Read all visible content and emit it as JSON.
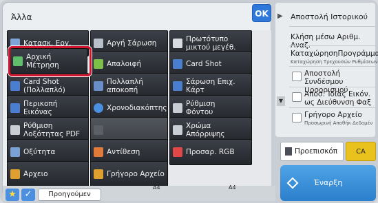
{
  "panel": {
    "title": "Άλλα",
    "ok_label": "OK"
  },
  "buttons": [
    {
      "label": "Κατασκ. Εργ.",
      "icon": "job-build-icon",
      "color": "#7fa4d8",
      "dim": false
    },
    {
      "label": "Αργή Σάρωση",
      "icon": "slow-scan-icon",
      "color": "#b9c0c9",
      "dim": false
    },
    {
      "label": "Πρωτότυπο\nμικτού μεγέθ.",
      "icon": "mixed-size-icon",
      "color": "#d9dde2",
      "dim": false
    },
    {
      "label": "Αρχική\nΜέτρηση",
      "icon": "original-count-icon",
      "color": "#5fbf6a",
      "dim": false
    },
    {
      "label": "Απαλοιφή",
      "icon": "erase-icon",
      "color": "#7cc04a",
      "dim": false
    },
    {
      "label": "Card Shot",
      "icon": "card-shot-icon",
      "color": "#4a7fd0",
      "dim": false
    },
    {
      "label": "Card Shot\n(Πολλαπλό)",
      "icon": "card-shot-multi-icon",
      "color": "#4a7fd0",
      "dim": false
    },
    {
      "label": "Πολλαπλή\nαποκοπή",
      "icon": "multi-crop-icon",
      "color": "#6a8fc8",
      "dim": false
    },
    {
      "label": "Σάρωση Επιχ.\nΚάρτ",
      "icon": "business-card-icon",
      "color": "#4a7fd0",
      "dim": false
    },
    {
      "label": "Περικοπή\nΕικόνας",
      "icon": "image-crop-icon",
      "color": "#4a7fd0",
      "dim": false
    },
    {
      "label": "Χρονοδιακόπτης",
      "icon": "timer-icon",
      "color": "#4a8fe0",
      "dim": false
    },
    {
      "label": "Ρύθμιση\nΦόντου",
      "icon": "background-icon",
      "color": "#c9ced4",
      "dim": false
    },
    {
      "label": "Ρύθμιση\nΛοξότητας PDF",
      "icon": "pdf-skew-icon",
      "color": "#c9ced4",
      "dim": false
    },
    {
      "label": "",
      "icon": "disabled-icon",
      "color": "#5b5f66",
      "dim": true
    },
    {
      "label": "Χρώμα\nΑπόρριψης",
      "icon": "color-drop-icon",
      "color": "#c9ced4",
      "dim": false
    },
    {
      "label": "Οξύτητα",
      "icon": "sharpness-icon",
      "color": "#7aa0d8",
      "dim": false
    },
    {
      "label": "Αντίθεση",
      "icon": "contrast-icon",
      "color": "#e07a3a",
      "dim": false
    },
    {
      "label": "Προσαρ. RGB",
      "icon": "rgb-icon",
      "color": "#e04848",
      "dim": false
    },
    {
      "label": "Αρχειο",
      "icon": "folder-icon",
      "color": "#e0a030",
      "dim": false
    },
    {
      "label": "Γρήγορο Αρχείο",
      "icon": "quick-file-icon",
      "color": "#e0a030",
      "dim": false
    }
  ],
  "right_panel": {
    "title": "Αποστολή Ιστορικού",
    "item1": "Κλήση μέσω Αριθμ. Αναζ.",
    "item2": "ΚαταχώρησηΠρογράμματος",
    "item2_sub": "Καταχώρηση Τρεχουσών Ρυθμίσεων",
    "item3": "Αποστολή Συνδέσμου\nΠροορισμού",
    "item4": "Αποσ. Ίδιας Εικόν.\nως Διεύθυνση Φαξ",
    "item5": "Γρήγορο Αρχείο",
    "item5_sub": "Προσωρινή Αποθήκ Δεδομέν"
  },
  "actions": {
    "preview": "Προεπισκόπ",
    "ca": "CA",
    "start": "Έναρξη"
  },
  "bottom": {
    "previous": "Προηγούμεν",
    "a4_left": "A4",
    "a4_right": "A4"
  }
}
